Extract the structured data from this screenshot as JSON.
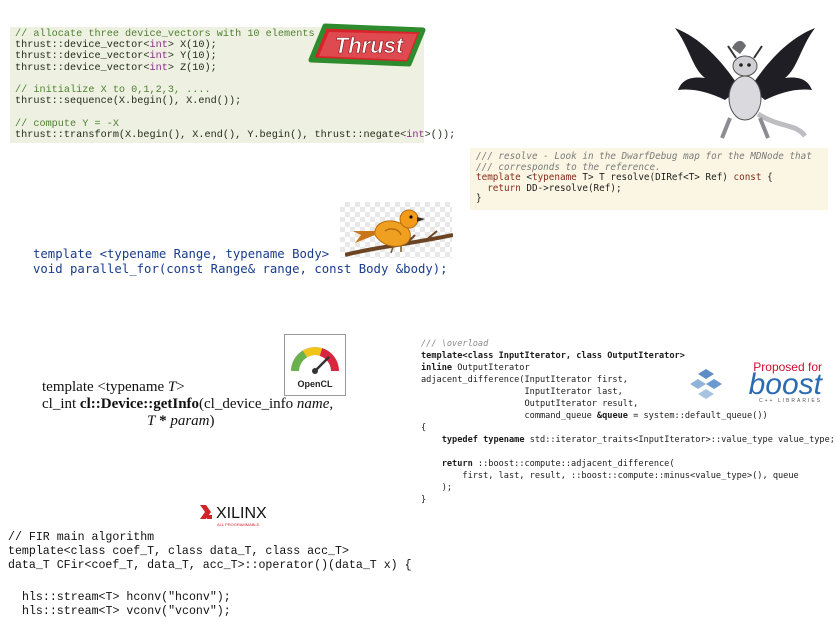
{
  "thrust": {
    "logo_text": "Thrust",
    "comment1": "// allocate three device_vectors with 10 elements",
    "decl_prefix": "thrust::device_vector<",
    "decl_type": "int",
    "decl_x": "> X(10);",
    "decl_y": "> Y(10);",
    "decl_z": "> Z(10);",
    "comment2": "// initialize X to 0,1,2,3, ....",
    "sequence": "thrust::sequence(X.begin(), X.end());",
    "comment3": "// compute Y = -X",
    "transform_prefix": "thrust::transform(X.begin(), X.end(), Y.begin(), thrust::negate<",
    "transform_type": "int",
    "transform_suffix": ">());"
  },
  "llvm": {
    "comment1": "/// resolve - Look in the DwarfDebug map for the MDNode that",
    "comment2": "/// corresponds to the reference.",
    "kw_template": "template",
    "kw_typename": "typename",
    "line3_a": " <",
    "line3_b": " T> T resolve(DIRef<T> Ref) ",
    "kw_const": "const",
    "line3_c": " {",
    "line4_indent": "  ",
    "kw_return": "return",
    "line4_b": " DD->resolve(Ref);",
    "line5": "}"
  },
  "tbb": {
    "line1": "template <typename Range, typename Body>",
    "line2": "void parallel_for(const Range& range, const Body &body);"
  },
  "opencl": {
    "logo_text": "OpenCL",
    "line1_a": "template <typename ",
    "line1_t": "T",
    "line1_b": ">",
    "line2_a": "cl_int ",
    "line2_bold": "cl::Device::getInfo",
    "line2_b": "(cl_device_info ",
    "line2_name": "name",
    "line2_c": ",",
    "line3_indent": "                            ",
    "line3_t": "T",
    "line3_star": " * ",
    "line3_param": "param",
    "line3_end": ")"
  },
  "boost": {
    "logo_proposed": "Proposed for",
    "logo_text": "boost",
    "logo_sub": "C++ LIBRARIES",
    "comment": "/// \\overload",
    "line2": "template<class InputIterator, class OutputIterator>",
    "line3_kw": "inline",
    "line3_rest": " OutputIterator",
    "line4": "adjacent_difference(InputIterator first,",
    "line5": "                    InputIterator last,",
    "line6": "                    OutputIterator result,",
    "line7_a": "                    command_queue ",
    "line7_bold": "&queue",
    "line7_b": " = system::default_queue())",
    "line8": "{",
    "line9_indent": "    ",
    "line9_kw1": "typedef",
    "line9_sp": " ",
    "line9_kw2": "typename",
    "line9_rest": " std::iterator_traits<InputIterator>::value_type value_type;",
    "line10": "",
    "line11_indent": "    ",
    "line11_kw": "return",
    "line11_rest": " ::boost::compute::adjacent_difference(",
    "line12": "        first, last, result, ::boost::compute::minus<value_type>(), queue",
    "line13": "    );",
    "line14": "}"
  },
  "xilinx": {
    "logo_text": "XILINX",
    "logo_sub": "ALL PROGRAMMABLE.",
    "line1": "// FIR main algorithm",
    "line2": "template<class coef_T, class data_T, class acc_T>",
    "line3": "data_T CFir<coef_T, data_T, acc_T>::operator()(data_T x) {",
    "line4": "hls::stream<T> hconv(\"hconv\");",
    "line5": "hls::stream<T> vconv(\"vconv\");"
  },
  "colors": {
    "thrust_bg": "#eef0e1",
    "thrust_logo_green": "#2e8b2e",
    "thrust_logo_red": "#d8232a",
    "llvm_bg": "#fbf6e4",
    "tbb_blue": "#1a3c8c",
    "boost_red": "#c8102e",
    "boost_blue": "#2b6cb0",
    "xilinx_red": "#d2232a"
  }
}
